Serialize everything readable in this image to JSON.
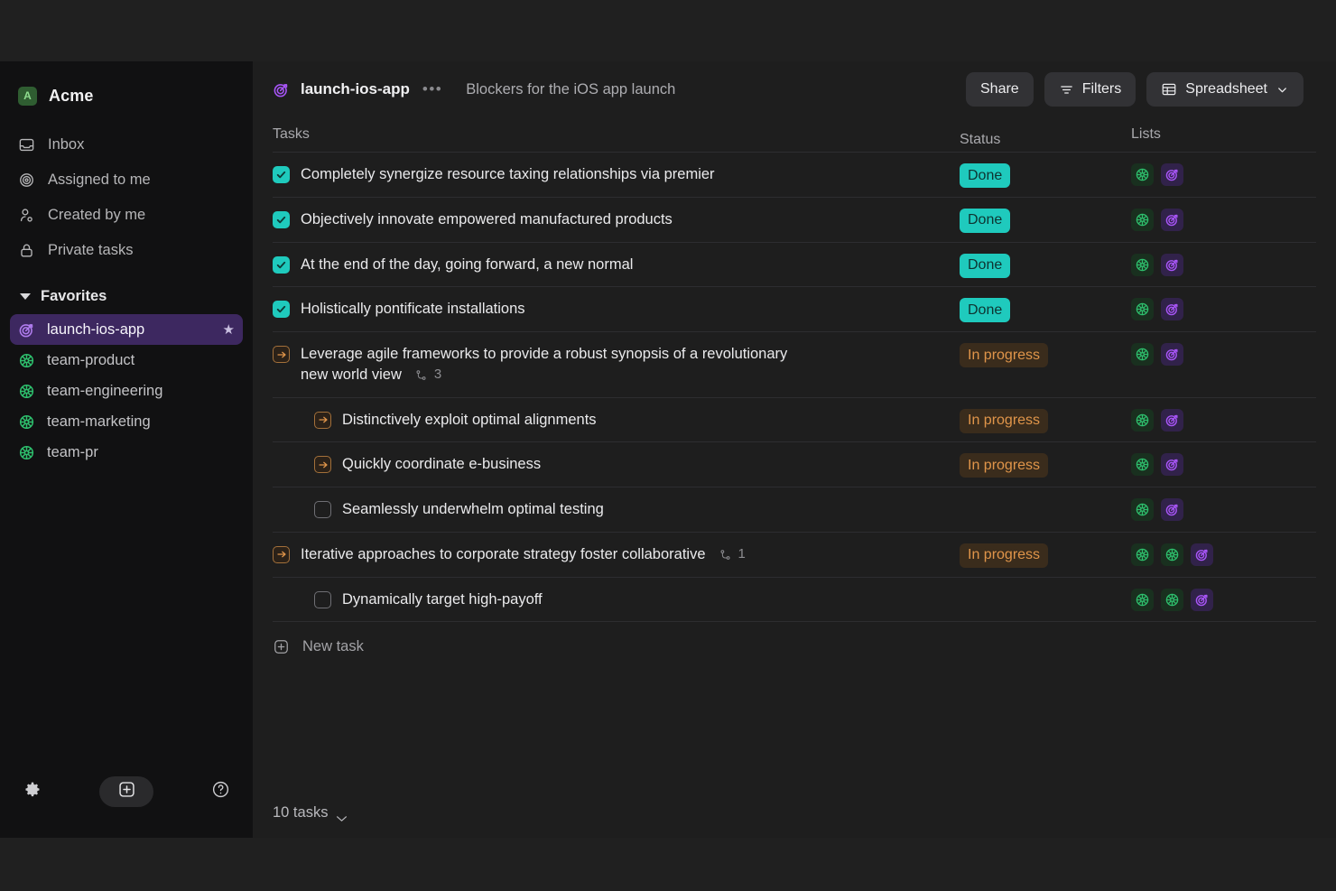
{
  "sidebar": {
    "workspace": {
      "badge": "A",
      "name": "Acme"
    },
    "nav": [
      {
        "label": "Inbox",
        "icon": "inbox-icon"
      },
      {
        "label": "Assigned to me",
        "icon": "target-circle-icon"
      },
      {
        "label": "Created by me",
        "icon": "user-icon"
      },
      {
        "label": "Private tasks",
        "icon": "lock-icon"
      }
    ],
    "favorites_label": "Favorites",
    "favorites": [
      {
        "label": "launch-ios-app",
        "icon": "goal-target-icon",
        "active": true,
        "starred": true
      },
      {
        "label": "team-product",
        "icon": "team-flower-icon",
        "active": false,
        "starred": false
      },
      {
        "label": "team-engineering",
        "icon": "team-flower-icon",
        "active": false,
        "starred": false
      },
      {
        "label": "team-marketing",
        "icon": "team-flower-icon",
        "active": false,
        "starred": false
      },
      {
        "label": "team-pr",
        "icon": "team-flower-icon",
        "active": false,
        "starred": false
      }
    ],
    "footer": {
      "settings": "gear-icon",
      "add": "plus-square-icon",
      "help": "question-circle-icon"
    }
  },
  "header": {
    "project_icon": "goal-target-icon",
    "project": "launch-ios-app",
    "more": "•••",
    "subtitle": "Blockers for the iOS app launch",
    "share_label": "Share",
    "filters_label": "Filters",
    "view_label": "Spreadsheet"
  },
  "columns": {
    "tasks": "Tasks",
    "status": "Status",
    "lists": "Lists"
  },
  "rows": [
    {
      "title": "Completely synergize resource taxing relationships via premier",
      "mark": "check",
      "status": "Done",
      "status_kind": "done",
      "child": false,
      "subcount": null,
      "chips": [
        "green",
        "purple"
      ]
    },
    {
      "title": "Objectively innovate empowered manufactured products",
      "mark": "check",
      "status": "Done",
      "status_kind": "done",
      "child": false,
      "subcount": null,
      "chips": [
        "green",
        "purple"
      ]
    },
    {
      "title": "At the end of the day, going forward, a new normal",
      "mark": "check",
      "status": "Done",
      "status_kind": "done",
      "child": false,
      "subcount": null,
      "chips": [
        "green",
        "purple"
      ]
    },
    {
      "title": "Holistically pontificate installations",
      "mark": "check",
      "status": "Done",
      "status_kind": "done",
      "child": false,
      "subcount": null,
      "chips": [
        "green",
        "purple"
      ]
    },
    {
      "title": "Leverage agile frameworks to provide a robust synopsis of a revolutionary new world view",
      "mark": "arrow",
      "status": "In progress",
      "status_kind": "progress",
      "child": false,
      "subcount": "3",
      "chips": [
        "green",
        "purple"
      ]
    },
    {
      "title": "Distinctively exploit optimal alignments",
      "mark": "arrow",
      "status": "In progress",
      "status_kind": "progress",
      "child": true,
      "subcount": null,
      "chips": [
        "green",
        "purple"
      ]
    },
    {
      "title": "Quickly coordinate e-business",
      "mark": "arrow",
      "status": "In progress",
      "status_kind": "progress",
      "child": true,
      "subcount": null,
      "chips": [
        "green",
        "purple"
      ]
    },
    {
      "title": "Seamlessly underwhelm optimal testing",
      "mark": "empty",
      "status": "",
      "status_kind": "none",
      "child": true,
      "subcount": null,
      "chips": [
        "green",
        "purple"
      ]
    },
    {
      "title": "Iterative approaches to corporate strategy foster collaborative",
      "mark": "arrow",
      "status": "In progress",
      "status_kind": "progress",
      "child": false,
      "subcount": "1",
      "chips": [
        "green",
        "green",
        "purple"
      ]
    },
    {
      "title": "Dynamically target high-payoff",
      "mark": "empty",
      "status": "",
      "status_kind": "none",
      "child": true,
      "subcount": null,
      "chips": [
        "green",
        "green",
        "purple"
      ]
    }
  ],
  "new_task_label": "New task",
  "footer": {
    "count_label": "10 tasks"
  },
  "colors": {
    "accent_teal": "#1fcabd",
    "accent_purple": "#8c4fe0",
    "accent_green": "#2fbf6a",
    "accent_orange": "#e0954a",
    "sidebar_bg": "#111112",
    "main_bg": "#1e1e1e"
  }
}
